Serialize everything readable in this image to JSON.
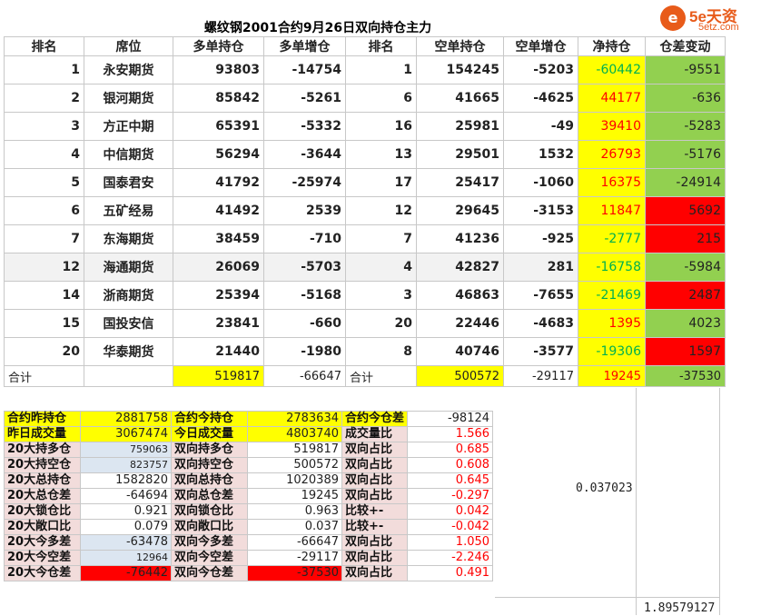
{
  "logo": {
    "mark": "e",
    "brand": "5e天资",
    "url": "5etz.com"
  },
  "title": "螺纹钢2001合约9月26日双向持仓主力",
  "headers": [
    "排名",
    "席位",
    "多单持仓",
    "多单增仓",
    "排名",
    "空单持仓",
    "空单增仓",
    "净持仓",
    "仓差变动"
  ],
  "rows": [
    {
      "rank_long": "1",
      "seat": "永安期货",
      "long": "93803",
      "long_chg": "-14754",
      "rank_short": "1",
      "short": "154245",
      "short_chg": "-5203",
      "net": "-60442",
      "diff": "-9551"
    },
    {
      "rank_long": "2",
      "seat": "银河期货",
      "long": "85842",
      "long_chg": "-5261",
      "rank_short": "6",
      "short": "41665",
      "short_chg": "-4625",
      "net": "44177",
      "diff": "-636"
    },
    {
      "rank_long": "3",
      "seat": "方正中期",
      "long": "65391",
      "long_chg": "-5332",
      "rank_short": "16",
      "short": "25981",
      "short_chg": "-49",
      "net": "39410",
      "diff": "-5283"
    },
    {
      "rank_long": "4",
      "seat": "中信期货",
      "long": "56294",
      "long_chg": "-3644",
      "rank_short": "13",
      "short": "29501",
      "short_chg": "1532",
      "net": "26793",
      "diff": "-5176"
    },
    {
      "rank_long": "5",
      "seat": "国泰君安",
      "long": "41792",
      "long_chg": "-25974",
      "rank_short": "17",
      "short": "25417",
      "short_chg": "-1060",
      "net": "16375",
      "diff": "-24914"
    },
    {
      "rank_long": "6",
      "seat": "五矿经易",
      "long": "41492",
      "long_chg": "2539",
      "rank_short": "12",
      "short": "29645",
      "short_chg": "-3153",
      "net": "11847",
      "diff": "5692"
    },
    {
      "rank_long": "7",
      "seat": "东海期货",
      "long": "38459",
      "long_chg": "-710",
      "rank_short": "7",
      "short": "41236",
      "short_chg": "-925",
      "net": "-2777",
      "diff": "215"
    },
    {
      "rank_long": "12",
      "seat": "海通期货",
      "long": "26069",
      "long_chg": "-5703",
      "rank_short": "4",
      "short": "42827",
      "short_chg": "281",
      "net": "-16758",
      "diff": "-5984"
    },
    {
      "rank_long": "14",
      "seat": "浙商期货",
      "long": "25394",
      "long_chg": "-5168",
      "rank_short": "3",
      "short": "46863",
      "short_chg": "-7655",
      "net": "-21469",
      "diff": "2487"
    },
    {
      "rank_long": "15",
      "seat": "国投安信",
      "long": "23841",
      "long_chg": "-660",
      "rank_short": "20",
      "short": "22446",
      "short_chg": "-4683",
      "net": "1395",
      "diff": "4023"
    },
    {
      "rank_long": "20",
      "seat": "华泰期货",
      "long": "21440",
      "long_chg": "-1980",
      "rank_short": "8",
      "short": "40746",
      "short_chg": "-3577",
      "net": "-19306",
      "diff": "1597"
    }
  ],
  "total": {
    "label1": "合计",
    "long": "519817",
    "long_chg": "-66647",
    "label2": "合计",
    "short": "500572",
    "short_chg": "-29117",
    "net": "19245",
    "diff": "-37530"
  },
  "stats": [
    {
      "l1": "合约昨持仓",
      "v1": "2881758",
      "l2": "合约今持仓",
      "v2": "2783634",
      "l3": "合约今仓差",
      "v3": "-98124"
    },
    {
      "l1": "昨日成交量",
      "v1": "3067474",
      "l2": "今日成交量",
      "v2": "4803740",
      "l3": "成交量比",
      "v3": "1.566"
    },
    {
      "l1": "20大持多仓",
      "v1": "759063",
      "l2": "双向持多仓",
      "v2": "519817",
      "l3": "双向占比",
      "v3": "0.685"
    },
    {
      "l1": "20大持空仓",
      "v1": "823757",
      "l2": "双向持空仓",
      "v2": "500572",
      "l3": "双向占比",
      "v3": "0.608"
    },
    {
      "l1": "20大总持仓",
      "v1": "1582820",
      "l2": "双向总持仓",
      "v2": "1020389",
      "l3": "双向占比",
      "v3": "0.645"
    },
    {
      "l1": "20大总仓差",
      "v1": "-64694",
      "l2": "双向总仓差",
      "v2": "19245",
      "l3": "双向占比",
      "v3": "-0.297"
    },
    {
      "l1": "20大锁仓比",
      "v1": "0.921",
      "l2": "双向锁仓比",
      "v2": "0.963",
      "l3": "比较+-",
      "v3": "0.042"
    },
    {
      "l1": "20大敞口比",
      "v1": "0.079",
      "l2": "双向敞口比",
      "v2": "0.037",
      "l3": "比较+-",
      "v3": "-0.042"
    },
    {
      "l1": "20大今多差",
      "v1": "-63478",
      "l2": "双向今多差",
      "v2": "-66647",
      "l3": "双向占比",
      "v3": "1.050"
    },
    {
      "l1": "20大今空差",
      "v1": "12964",
      "l2": "双向今空差",
      "v2": "-29117",
      "l3": "双向占比",
      "v3": "-2.246"
    },
    {
      "l1": "20大今仓差",
      "v1": "-76442",
      "l2": "双向今仓差",
      "v2": "-37530",
      "l3": "双向占比",
      "v3": "0.491"
    }
  ],
  "extra1": "0.037023",
  "extra2": "1.89579127",
  "colors": {
    "yellow": "#ffff00",
    "green": "#92d050",
    "red": "#ff0000",
    "pink": "#f2dcdb",
    "blue": "#dce6f1"
  }
}
